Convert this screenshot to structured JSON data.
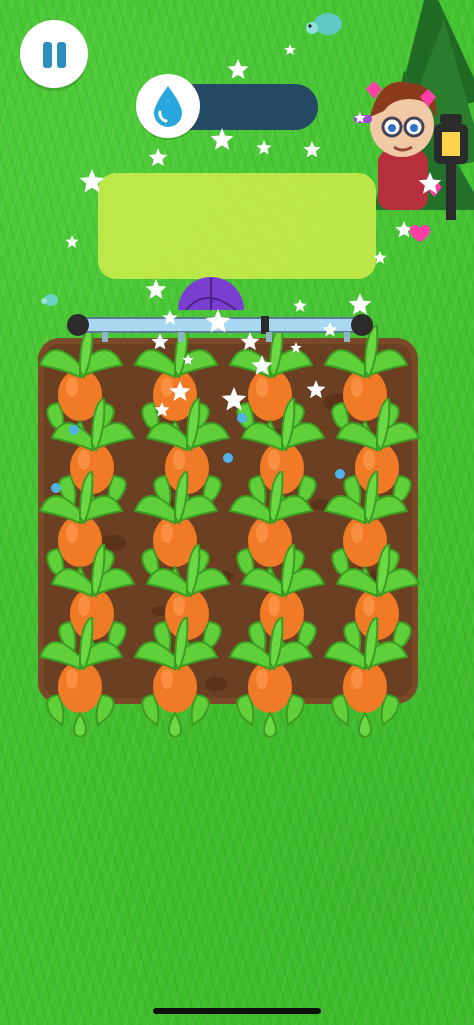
{
  "hud": {
    "pause_icon": "pause-icon",
    "water_icon": "water-drop-icon",
    "water_level": 0.0
  },
  "colors": {
    "grass": "#45c232",
    "soil": "#6a3f22",
    "panel": "#c3e94a",
    "water_track": "#254a63",
    "carrot": "#f07a25",
    "leaf": "#5fcf3a"
  },
  "field": {
    "rows": 5,
    "columns": 4,
    "crop": "carrot"
  }
}
